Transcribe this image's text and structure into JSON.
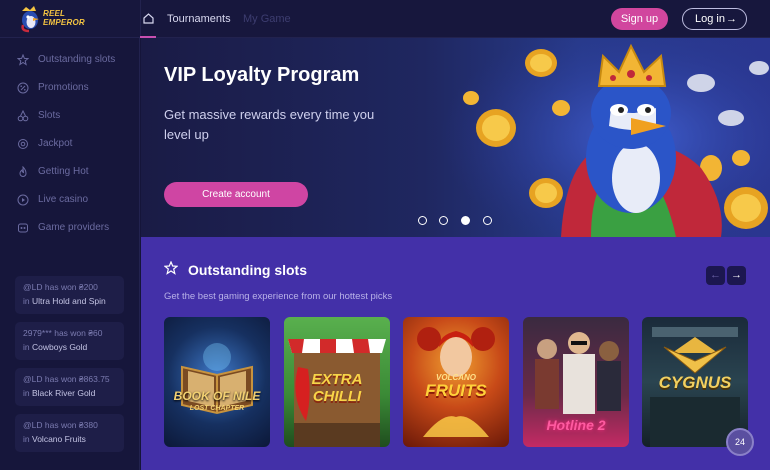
{
  "brand": {
    "line1": "REEL",
    "line2": "EMPEROR"
  },
  "nav": {
    "tournaments": "Tournaments",
    "my_game": "My Game"
  },
  "header": {
    "signup": "Sign up",
    "login": "Log in",
    "login_arrow": "→"
  },
  "sidebar": {
    "items": [
      {
        "label": "Outstanding slots",
        "icon": "star-icon"
      },
      {
        "label": "Promotions",
        "icon": "percent-icon"
      },
      {
        "label": "Slots",
        "icon": "cherries-icon"
      },
      {
        "label": "Jackpot",
        "icon": "jackpot-icon"
      },
      {
        "label": "Getting Hot",
        "icon": "flame-icon"
      },
      {
        "label": "Live casino",
        "icon": "play-icon"
      },
      {
        "label": "Game providers",
        "icon": "providers-icon"
      }
    ],
    "wins": [
      {
        "who": "@LD",
        "text": "has won",
        "amount": "₴200",
        "in": "in",
        "game": "Ultra Hold and Spin"
      },
      {
        "who": "2979***",
        "text": "has won",
        "amount": "₴60",
        "in": "in",
        "game": "Cowboys Gold"
      },
      {
        "who": "@LD",
        "text": "has won",
        "amount": "₴863.75",
        "in": "in",
        "game": "Black River Gold"
      },
      {
        "who": "@LD",
        "text": "has won",
        "amount": "₴380",
        "in": "in",
        "game": "Volcano Fruits"
      }
    ]
  },
  "banner": {
    "title": "VIP Loyalty Program",
    "subtitle": "Get massive rewards every time you level up",
    "cta": "Create account",
    "slide_count": 4,
    "active_slide": 3
  },
  "outstanding": {
    "title": "Outstanding slots",
    "subtitle": "Get the best gaming experience from our hottest picks",
    "prev": "←",
    "next": "→",
    "games": [
      {
        "name": "Book of Nile: Lost Chapter",
        "logo_line1": "BOOK OF NILE",
        "logo_line2": "LOST CHAPTER"
      },
      {
        "name": "Extra Chilli",
        "logo_line1": "EXTRA",
        "logo_line2": "CHILLI"
      },
      {
        "name": "Volcano Fruits",
        "logo_line1": "VOLCANO",
        "logo_line2": "FRUITS"
      },
      {
        "name": "Hotline 2",
        "logo_line1": "Hotline 2",
        "logo_line2": ""
      },
      {
        "name": "Cygnus",
        "logo_line1": "CYGNUS",
        "logo_line2": ""
      }
    ]
  },
  "support": {
    "label": "24"
  },
  "colors": {
    "accent": "#d1469e",
    "section_bg": "#4330a8",
    "sidebar_bg": "#16163b"
  }
}
